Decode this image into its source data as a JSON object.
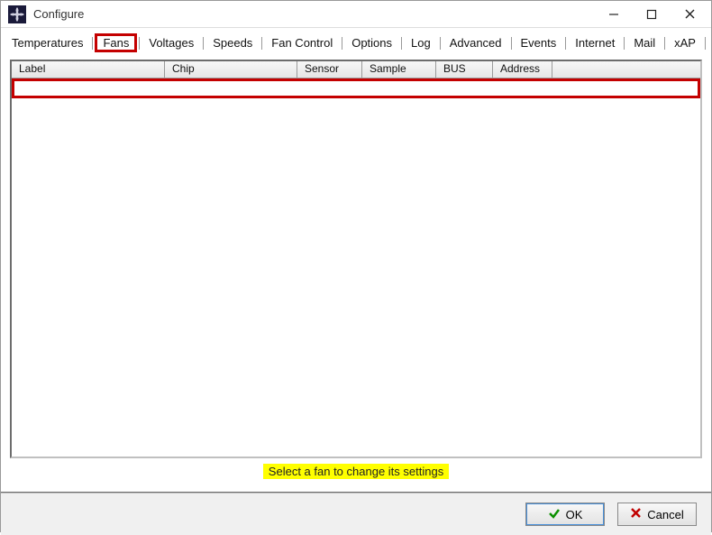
{
  "window": {
    "title": "Configure"
  },
  "tabs": {
    "items": [
      {
        "label": "Temperatures"
      },
      {
        "label": "Fans"
      },
      {
        "label": "Voltages"
      },
      {
        "label": "Speeds"
      },
      {
        "label": "Fan Control"
      },
      {
        "label": "Options"
      },
      {
        "label": "Log"
      },
      {
        "label": "Advanced"
      },
      {
        "label": "Events"
      },
      {
        "label": "Internet"
      },
      {
        "label": "Mail"
      },
      {
        "label": "xAP"
      }
    ],
    "active_index": 1
  },
  "columns": {
    "label": "Label",
    "chip": "Chip",
    "sensor": "Sensor",
    "sample": "Sample",
    "bus": "BUS",
    "address": "Address"
  },
  "hint": "Select a fan to change its settings",
  "buttons": {
    "ok": "OK",
    "cancel": "Cancel"
  }
}
